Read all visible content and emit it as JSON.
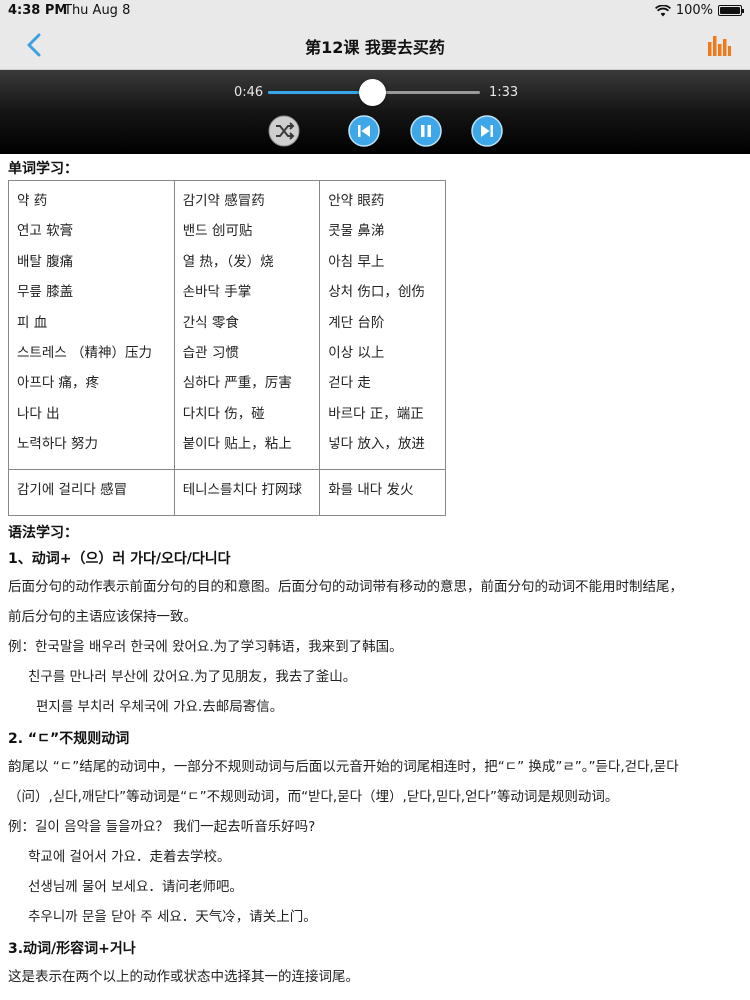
{
  "status": {
    "time": "4:38 PM",
    "date": "Thu Aug 8",
    "battery": "100%"
  },
  "nav": {
    "title": "第12课 我要去买药"
  },
  "player": {
    "current": "0:46",
    "total": "1:33",
    "progress": 0.49
  },
  "vocab": {
    "title": "单词学习：",
    "columns": [
      [
        "약  药",
        "연고  软膏",
        "배탈  腹痛",
        "무릎  膝盖",
        "피  血",
        "스트레스  （精神）压力",
        "아프다  痛，疼",
        "나다  出",
        "노력하다  努力"
      ],
      [
        "감기약  感冒药",
        "밴드  创可贴",
        "열  热，（发）烧",
        "손바닥  手掌",
        "간식  零食",
        "습관  习惯",
        "심하다  严重，厉害",
        "다치다  伤，碰",
        "붙이다  贴上，粘上"
      ],
      [
        "안약  眼药",
        "콧물  鼻涕",
        "아침  早上",
        "상처  伤口，创伤",
        "계단  台阶",
        "이상  以上",
        "걷다  走",
        "바르다  正，端正",
        "넣다  放入，放进"
      ]
    ],
    "last": [
      "감기에 걸리다  感冒",
      "테니스를치다  打网球",
      "화를 내다  发火"
    ]
  },
  "grammar": {
    "title": "语法学习：",
    "g1": {
      "heading": "1、动词+（으）러 가다/오다/다니다",
      "p1": "后面分句的动作表示前面分句的目的和意图。后面分句的动词带有移动的意思，前面分句的动词不能用时制结尾，",
      "p2": "前后分句的主语应该保持一致。",
      "ex1": "例：한국말을 배우러 한국에 왔어요.为了学习韩语，我来到了韩国。",
      "ex2": "친구를 만나러 부산에 갔어요.为了见朋友，我去了釜山。",
      "ex3": "편지를 부치러 우체국에 가요.去邮局寄信。"
    },
    "g2": {
      "heading": "2. “ㄷ”不规则动词",
      "p1": "韵尾以 “ㄷ”结尾的动词中，一部分不规则动词与后面以元音开始的词尾相连时，把“ㄷ” 换成”ㄹ”。”듣다,걷다,묻다",
      "p2": "（问）,싣다,깨닫다”等动词是“ㄷ”不规则动词，而“받다,묻다（埋）,닫다,믿다,얻다”等动词是规则动词。",
      "ex1": "例：길이 음악을 들을까요？ 我们一起去听音乐好吗?",
      "ex2": "학교에 걸어서 가요．走着去学校。",
      "ex3": "선생님께 물어 보세요．请问老师吧。",
      "ex4": "추우니까 문을 닫아 주 세요．天气冷，请关上门。"
    },
    "g3": {
      "heading": "3.动词/形容词+거나",
      "p1": "这是表示在两个以上的动作或状态中选择其一的连接词尾。"
    }
  },
  "colors": {
    "accent": "#35a6e8",
    "chart": "#f07a1a"
  }
}
